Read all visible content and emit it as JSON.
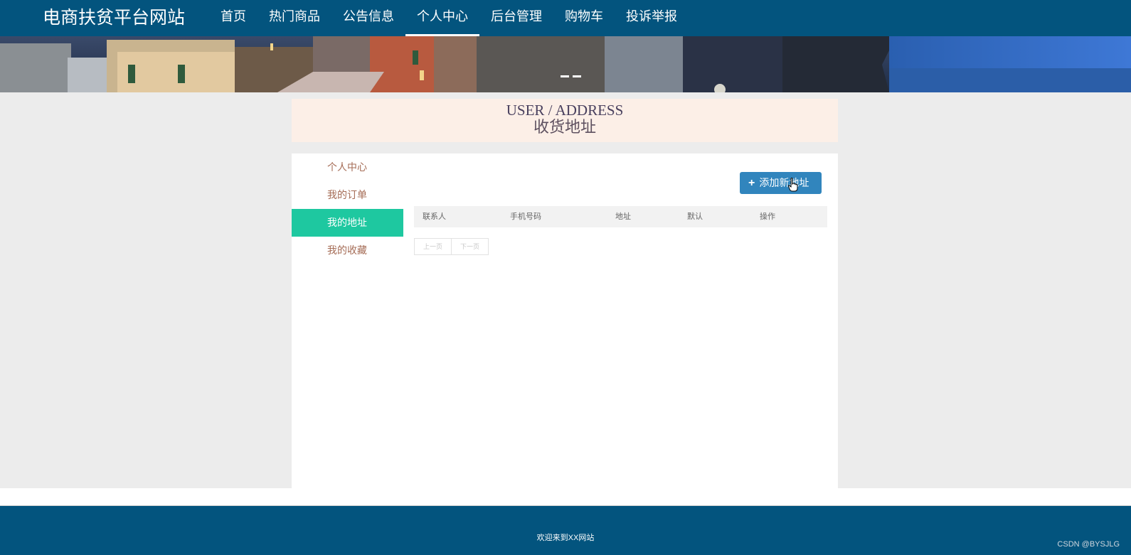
{
  "header": {
    "brand": "电商扶贫平台网站",
    "nav": [
      {
        "label": "首页"
      },
      {
        "label": "热门商品"
      },
      {
        "label": "公告信息"
      },
      {
        "label": "个人中心",
        "active": true
      },
      {
        "label": "后台管理"
      },
      {
        "label": "购物车"
      },
      {
        "label": "投诉举报"
      }
    ]
  },
  "banner": {
    "slides": 2,
    "active_slide": 1
  },
  "section": {
    "title_en": "USER / ADDRESS",
    "title_cn": "收货地址"
  },
  "sidebar": {
    "items": [
      {
        "label": "个人中心"
      },
      {
        "label": "我的订单"
      },
      {
        "label": "我的地址",
        "active": true
      },
      {
        "label": "我的收藏"
      }
    ]
  },
  "actions": {
    "add_icon": "plus-icon",
    "add_label": "添加新地址"
  },
  "table": {
    "columns": [
      "联系人",
      "手机号码",
      "地址",
      "默认",
      "操作"
    ],
    "rows": []
  },
  "pagination": {
    "prev": "上一页",
    "next": "下一页"
  },
  "footer": {
    "text": "欢迎来到XX网站",
    "watermark": "CSDN @BYSJLG"
  },
  "colors": {
    "nav_bg": "#03547e",
    "sidebar_active": "#1ec8a0",
    "button_bg": "#3185bd",
    "title_bg": "#fcefe7"
  }
}
